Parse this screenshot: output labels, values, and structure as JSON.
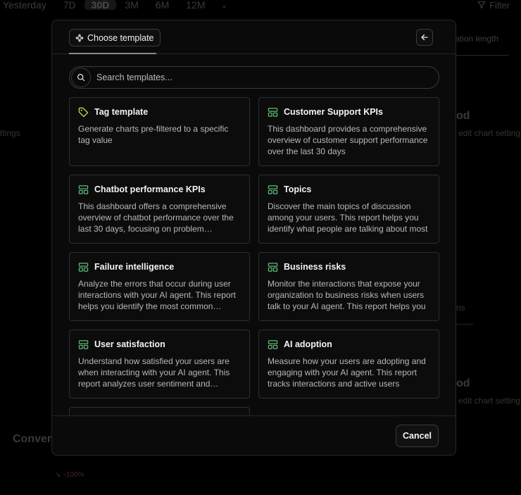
{
  "background": {
    "range_options": [
      "Yesterday",
      "7D",
      "30D",
      "3M",
      "6M",
      "12M"
    ],
    "range_selected": "30D",
    "filter_label": "Filter",
    "tab_fragment": "sation length",
    "settings_left": "ttings",
    "heading_right_1": "od",
    "edit_chart_1": "edit chart setting",
    "tab_fragment_2": "ns",
    "heading_right_2": "od",
    "edit_chart_2": "edit chart setting",
    "conv_heading": "Conver",
    "neg_value": "-100%"
  },
  "modal": {
    "tab_label": "Choose template",
    "search_placeholder": "Search templates...",
    "cancel_label": "Cancel",
    "colors": {
      "tag_icon": "#d7e05a",
      "layout_icon": "#5fbf77"
    },
    "templates": [
      {
        "icon": "tag-icon",
        "title": "Tag template",
        "description": "Generate charts pre-filtered to a specific tag value"
      },
      {
        "icon": "layout-template-icon",
        "title": "Customer Support KPIs",
        "description": "This dashboard provides a comprehensive overview of customer support performance over the last 30 days"
      },
      {
        "icon": "layout-template-icon",
        "title": "Chatbot performance KPIs",
        "description": "This dashboard offers a comprehensive overview of chatbot performance over the last 30 days, focusing on problem resolution"
      },
      {
        "icon": "layout-template-icon",
        "title": "Topics",
        "description": "Discover the main topics of discussion among your users. This report helps you identify what people are talking about most"
      },
      {
        "icon": "layout-template-icon",
        "title": "Failure intelligence",
        "description": "Analyze the errors that occur during user interactions with your AI agent. This report helps you identify the most common failures"
      },
      {
        "icon": "layout-template-icon",
        "title": "Business risks",
        "description": "Monitor the interactions that expose your organization to business risks when users talk to your AI agent. This report helps you"
      },
      {
        "icon": "layout-template-icon",
        "title": "User satisfaction",
        "description": "Understand how satisfied your users are when interacting with your AI agent. This report analyzes user sentiment and feedback"
      },
      {
        "icon": "layout-template-icon",
        "title": "AI adoption",
        "description": "Measure how your users are adopting and engaging with your AI agent. This report tracks interactions and active users"
      }
    ]
  }
}
